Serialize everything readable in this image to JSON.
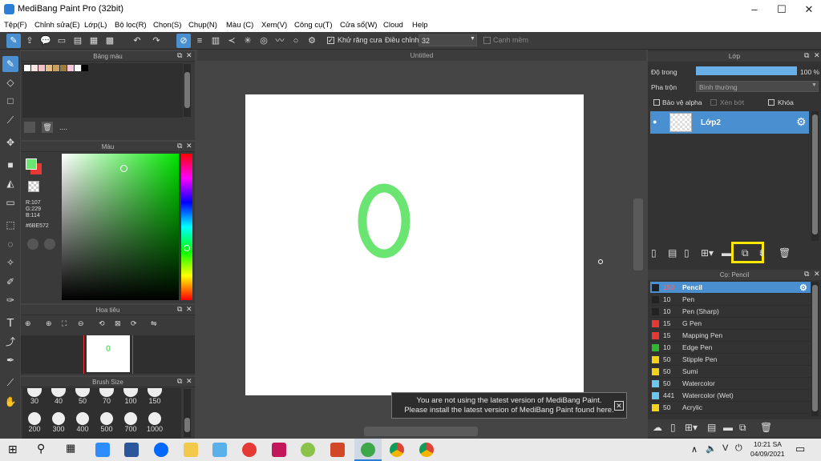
{
  "window": {
    "title": "MediBang Paint Pro (32bit)"
  },
  "menu": [
    "Tệp(F)",
    "Chỉnh sửa(E)",
    "Lớp(L)",
    "Bộ lọc(R)",
    "Chọn(S)",
    "Chụp(N)",
    "Màu (C)",
    "Xem(V)",
    "Công cụ(T)",
    "Cửa sổ(W)",
    "Cloud",
    "Help"
  ],
  "toolbar": {
    "antialias_label": "Khử răng cưa",
    "adjust_label": "Điều chỉnh",
    "adjust_value": "32",
    "smooth_edge_label": "Cạnh mềm"
  },
  "palette": {
    "title": "Bảng màu",
    "dots": "...."
  },
  "color_panel": {
    "title": "Màu",
    "r": "R:107",
    "g": "G:229",
    "b": "B:114",
    "hex": "#6BE572"
  },
  "navigator": {
    "title": "Hoa tiêu"
  },
  "brush_size": {
    "title": "Brush Size",
    "sizes_row1": [
      "30",
      "40",
      "50",
      "70",
      "100",
      "150"
    ],
    "sizes_row2": [
      "200",
      "300",
      "400",
      "500",
      "700",
      "1000"
    ]
  },
  "canvas": {
    "title": "Untitled",
    "drawing_char": "0"
  },
  "layer_panel": {
    "title": "Lớp",
    "opacity_label": "Độ trong",
    "opacity_value": "100 %",
    "blend_label": "Pha trộn",
    "blend_value": "Bình thường",
    "protect_alpha": "Bảo vệ alpha",
    "clipping": "Xén bớt",
    "lock": "Khóa",
    "layer_name": "Lớp2"
  },
  "brush_panel": {
    "title": "Cọ: Pencil",
    "items": [
      {
        "size": "150",
        "name": "Pencil",
        "color": "#222222"
      },
      {
        "size": "10",
        "name": "Pen",
        "color": "#222222"
      },
      {
        "size": "10",
        "name": "Pen (Sharp)",
        "color": "#222222"
      },
      {
        "size": "15",
        "name": "G Pen",
        "color": "#e53935"
      },
      {
        "size": "15",
        "name": "Mapping Pen",
        "color": "#e53935"
      },
      {
        "size": "10",
        "name": "Edge Pen",
        "color": "#2eb82e"
      },
      {
        "size": "50",
        "name": "Stipple Pen",
        "color": "#f2d21b"
      },
      {
        "size": "50",
        "name": "Sumi",
        "color": "#f2d21b"
      },
      {
        "size": "50",
        "name": "Watercolor",
        "color": "#6cc7ee"
      },
      {
        "size": "441",
        "name": "Watercolor (Wet)",
        "color": "#6cc7ee"
      },
      {
        "size": "50",
        "name": "Acrylic",
        "color": "#f2d21b"
      }
    ]
  },
  "notice": {
    "line1": "You are not using the latest version of MediBang Paint.",
    "line2": "Please install the latest version of MediBang Paint found here."
  },
  "taskbar": {
    "time": "10:21 SA",
    "date": "04/09/2021",
    "lang": "V"
  }
}
